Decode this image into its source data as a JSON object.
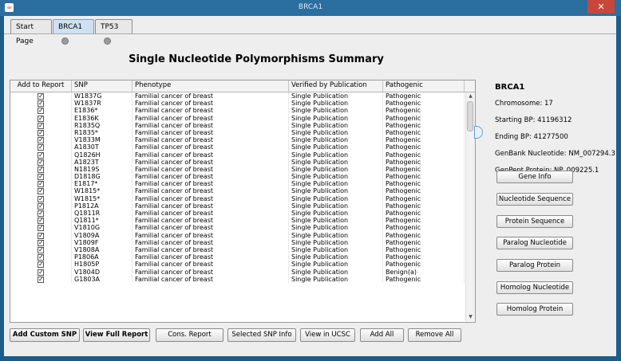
{
  "window": {
    "title": "BRCA1"
  },
  "tabs": [
    {
      "label": "Start Page",
      "closable": false,
      "active": false
    },
    {
      "label": "BRCA1",
      "closable": true,
      "active": true
    },
    {
      "label": "TP53",
      "closable": true,
      "active": false
    }
  ],
  "heading": "Single Nucleotide Polymorphisms Summary",
  "table": {
    "columns": [
      "Add to Report",
      "SNP",
      "Phenotype",
      "Verified by Publication",
      "Pathogenic"
    ],
    "rows": [
      [
        "W1837G",
        "Familial cancer of breast",
        "Single Publication",
        "Pathogenic"
      ],
      [
        "W1837R",
        "Familial cancer of breast",
        "Single Publication",
        "Pathogenic"
      ],
      [
        "E1836*",
        "Familial cancer of breast",
        "Single Publication",
        "Pathogenic"
      ],
      [
        "E1836K",
        "Familial cancer of breast",
        "Single Publication",
        "Pathogenic"
      ],
      [
        "R1835Q",
        "Familial cancer of breast",
        "Single Publication",
        "Pathogenic"
      ],
      [
        "R1835*",
        "Familial cancer of breast",
        "Single Publication",
        "Pathogenic"
      ],
      [
        "V1833M",
        "Familial cancer of breast",
        "Single Publication",
        "Pathogenic"
      ],
      [
        "A1830T",
        "Familial cancer of breast",
        "Single Publication",
        "Pathogenic"
      ],
      [
        "Q1826H",
        "Familial cancer of breast",
        "Single Publication",
        "Pathogenic"
      ],
      [
        "A1823T",
        "Familial cancer of breast",
        "Single Publication",
        "Pathogenic"
      ],
      [
        "N1819S",
        "Familial cancer of breast",
        "Single Publication",
        "Pathogenic"
      ],
      [
        "D1818G",
        "Familial cancer of breast",
        "Single Publication",
        "Pathogenic"
      ],
      [
        "E1817*",
        "Familial cancer of breast",
        "Single Publication",
        "Pathogenic"
      ],
      [
        "W1815*",
        "Familial cancer of breast",
        "Single Publication",
        "Pathogenic"
      ],
      [
        "W1815*",
        "Familial cancer of breast",
        "Single Publication",
        "Pathogenic"
      ],
      [
        "P1812A",
        "Familial cancer of breast",
        "Single Publication",
        "Pathogenic"
      ],
      [
        "Q1811R",
        "Familial cancer of breast",
        "Single Publication",
        "Pathogenic"
      ],
      [
        "Q1811*",
        "Familial cancer of breast",
        "Single Publication",
        "Pathogenic"
      ],
      [
        "V1810G",
        "Familial cancer of breast",
        "Single Publication",
        "Pathogenic"
      ],
      [
        "V1809A",
        "Familial cancer of breast",
        "Single Publication",
        "Pathogenic"
      ],
      [
        "V1809F",
        "Familial cancer of breast",
        "Single Publication",
        "Pathogenic"
      ],
      [
        "V1808A",
        "Familial cancer of breast",
        "Single Publication",
        "Pathogenic"
      ],
      [
        "P1806A",
        "Familial cancer of breast",
        "Single Publication",
        "Pathogenic"
      ],
      [
        "H1805P",
        "Familial cancer of breast",
        "Single Publication",
        "Pathogenic"
      ],
      [
        "V1804D",
        "Familial cancer of breast",
        "Single Publication",
        "Benign(a)"
      ],
      [
        "G1803A",
        "Familial cancer of breast",
        "Single Publication",
        "Pathogenic"
      ]
    ]
  },
  "gene": {
    "name": "BRCA1",
    "info": [
      "Chromosome: 17",
      "Starting BP: 41196312",
      "Ending BP: 41277500",
      "GenBank Nucleotide: NM_007294.3",
      "GenPept Protein: NP_009225.1"
    ]
  },
  "side_buttons": [
    "Gene Info",
    "Nucleotide Sequence",
    "Protein Sequence",
    "Paralog Nucleotide",
    "Paralog Protein",
    "Homolog Nucleotide",
    "Homolog Protein"
  ],
  "bottom_buttons": [
    "Add Custom SNP",
    "View Full Report",
    "Cons. Report",
    "Selected SNP Info",
    "View in UCSC",
    "Add All",
    "Remove All"
  ],
  "icons": {
    "check": "✓",
    "window_close": "✕",
    "scroll_up": "▲",
    "scroll_down": "▼"
  }
}
